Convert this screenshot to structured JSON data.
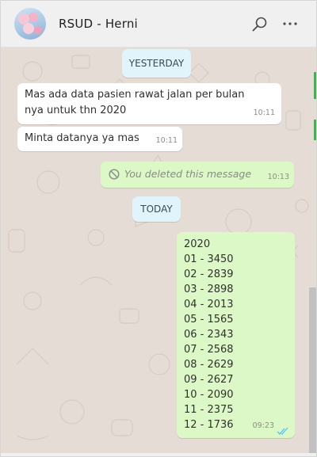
{
  "header": {
    "contact_name": "RSUD - Herni",
    "icons": [
      "avatar",
      "search-icon",
      "more-options-icon"
    ]
  },
  "colors": {
    "chat_background": "#e5ddd5",
    "incoming_bubble": "#ffffff",
    "outgoing_bubble": "#dcf8c6",
    "date_pill": "#e1f3fb",
    "read_ticks": "#4fc3f7"
  },
  "dividers": {
    "yesterday": "YESTERDAY",
    "today": "TODAY"
  },
  "messages": [
    {
      "direction": "incoming",
      "text": "Mas ada data pasien rawat jalan per bulan nya untuk thn 2020",
      "time": "10:11"
    },
    {
      "direction": "incoming",
      "text": "Minta datanya ya mas",
      "time": "10:11"
    },
    {
      "direction": "outgoing",
      "text": "You deleted this message",
      "time": "10:13",
      "icon": "prohibited-icon"
    },
    {
      "direction": "outgoing",
      "year": "2020",
      "lines": [
        "01 - 3450",
        "02 - 2839",
        "03 - 2898",
        "04 - 2013",
        "05 - 1565",
        "06 - 2343",
        "07 - 2568",
        "08 - 2629",
        "09 - 2627",
        "10 - 2090",
        "11 - 2375",
        "12 - 1736"
      ],
      "time": "09:23",
      "status_icon": "double-check-icon"
    }
  ]
}
